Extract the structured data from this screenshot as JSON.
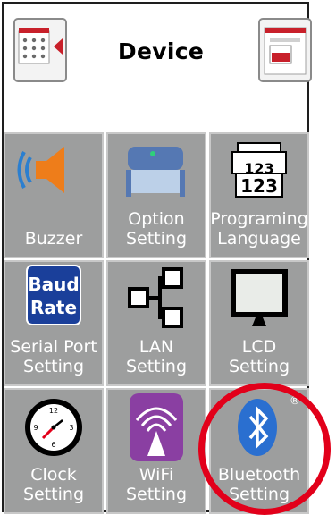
{
  "header": {
    "title": "Device"
  },
  "tiles": [
    {
      "id": "buzzer",
      "lines": [
        "",
        "Buzzer"
      ],
      "icon": "speaker-icon"
    },
    {
      "id": "option",
      "lines": [
        "Option",
        "Setting"
      ],
      "icon": "option-module-icon"
    },
    {
      "id": "language",
      "lines": [
        "Programing",
        "Language"
      ],
      "icon": "printer-123-icon"
    },
    {
      "id": "serial",
      "lines": [
        "Serial Port",
        "Setting"
      ],
      "icon": "baud-rate-icon",
      "icon_text": [
        "Baud",
        "Rate"
      ]
    },
    {
      "id": "lan",
      "lines": [
        "LAN",
        "Setting"
      ],
      "icon": "network-icon"
    },
    {
      "id": "lcd",
      "lines": [
        "LCD",
        "Setting"
      ],
      "icon": "monitor-icon"
    },
    {
      "id": "clock",
      "lines": [
        "Clock",
        "Setting"
      ],
      "icon": "clock-icon",
      "clock_numbers": [
        "12",
        "3",
        "6",
        "9"
      ]
    },
    {
      "id": "wifi",
      "lines": [
        "WiFi",
        "Setting"
      ],
      "icon": "wifi-icon"
    },
    {
      "id": "bluetooth",
      "lines": [
        "Bluetooth",
        "Setting"
      ],
      "icon": "bluetooth-icon",
      "mark": "®"
    }
  ],
  "colors": {
    "tile": "#9d9e9e",
    "highlight": "#e2001a",
    "accent": "#c8202a"
  }
}
